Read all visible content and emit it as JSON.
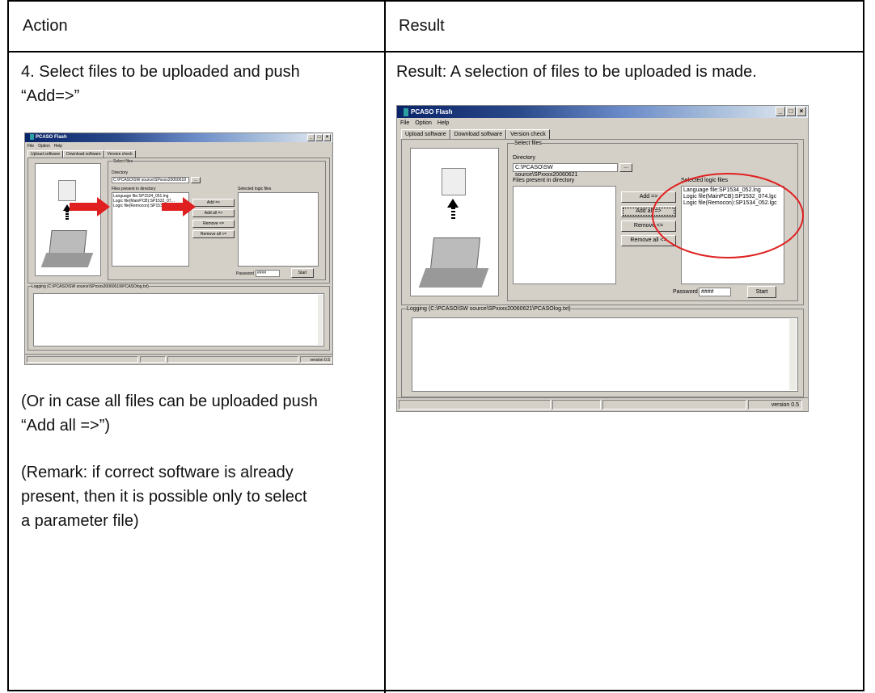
{
  "table": {
    "header_action": "Action",
    "header_result": "Result"
  },
  "action": {
    "step_line1": "4. Select files to be uploaded and push",
    "step_line2": "“Add=>”",
    "alt_line1": "(Or in case all files can be uploaded push",
    "alt_line2": "“Add all =>”)",
    "remark_line1": "(Remark: if correct software is already",
    "remark_line2": "present, then it is possible only to select",
    "remark_line3": "a parameter file)"
  },
  "result": {
    "text": "Result: A selection of files to be uploaded is made."
  },
  "app": {
    "title": "PCASO Flash",
    "menu": [
      "File",
      "Option",
      "Help"
    ],
    "tabs": [
      "Upload software",
      "Download software",
      "Version check"
    ],
    "select_files_label": "Select files",
    "directory_label": "Directory",
    "files_present_label": "Files present in directory",
    "selected_logic_label": "Selected logic files",
    "password_label": "Password",
    "password_value": "####",
    "start_label": "Start",
    "add_label": "Add =>",
    "add_all_label": "Add all =>",
    "remove_label": "Remove <=",
    "remove_all_label": "Remove all <=",
    "browse_label": "...",
    "version": "version 0.5",
    "accent_red": "#e02020"
  },
  "left_shot": {
    "directory_value": "C:\\PCASO\\SW source\\SPxxxx20060619",
    "files": [
      "Language file:SP1534_051.lng",
      "Logic file(MainPCB):SP1532_07...",
      "Logic file(Remocon):SP1534_051.lgc"
    ],
    "logging_label": "Logging (C:\\PCASO\\SW source\\SPxxxx20060619\\PCASOlog.txt)"
  },
  "right_shot": {
    "directory_value": "C:\\PCASO\\SW source\\SPxxxx20060621",
    "selected_files": [
      "Language file:SP1534_052.lng",
      "Logic file(MainPCB):SP1532_074.lgc",
      "Logic file(Remocon):SP1534_052.lgc"
    ],
    "logging_label": "Logging (C:\\PCASO\\SW source\\SPxxxx20060621\\PCASOlog.txt)"
  }
}
